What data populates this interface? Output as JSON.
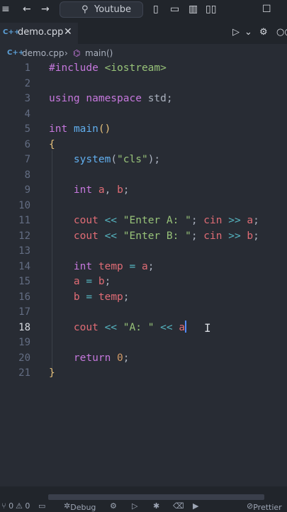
{
  "title_bar": {
    "search_text": "Youtube",
    "back_icon": "←",
    "forward_icon": "→",
    "search_icon": "⚲",
    "layout_icons": [
      "▯",
      "▭",
      "▥",
      "▯▯"
    ],
    "maximize_icon": "☐"
  },
  "tab": {
    "badge": "C++",
    "label": "demo.cpp",
    "close": "✕"
  },
  "tab_actions": {
    "run": "▷",
    "run_dropdown": "⌄",
    "settings": "⚙",
    "more": "○○"
  },
  "breadcrumb": {
    "file_badge": "C++",
    "file": "demo.cpp",
    "separator": "›",
    "symbol_icon": "⌬",
    "symbol": "main()"
  },
  "editor": {
    "active_line": 18,
    "line_numbers": [
      "1",
      "2",
      "3",
      "4",
      "5",
      "6",
      "7",
      "8",
      "9",
      "10",
      "11",
      "12",
      "13",
      "14",
      "15",
      "16",
      "17",
      "18",
      "19",
      "20",
      "21"
    ]
  },
  "status_bar": {
    "branch": "⑂ 0",
    "warnings": "⚠ 0",
    "debug": "Debug",
    "formatter": "Prettier"
  }
}
